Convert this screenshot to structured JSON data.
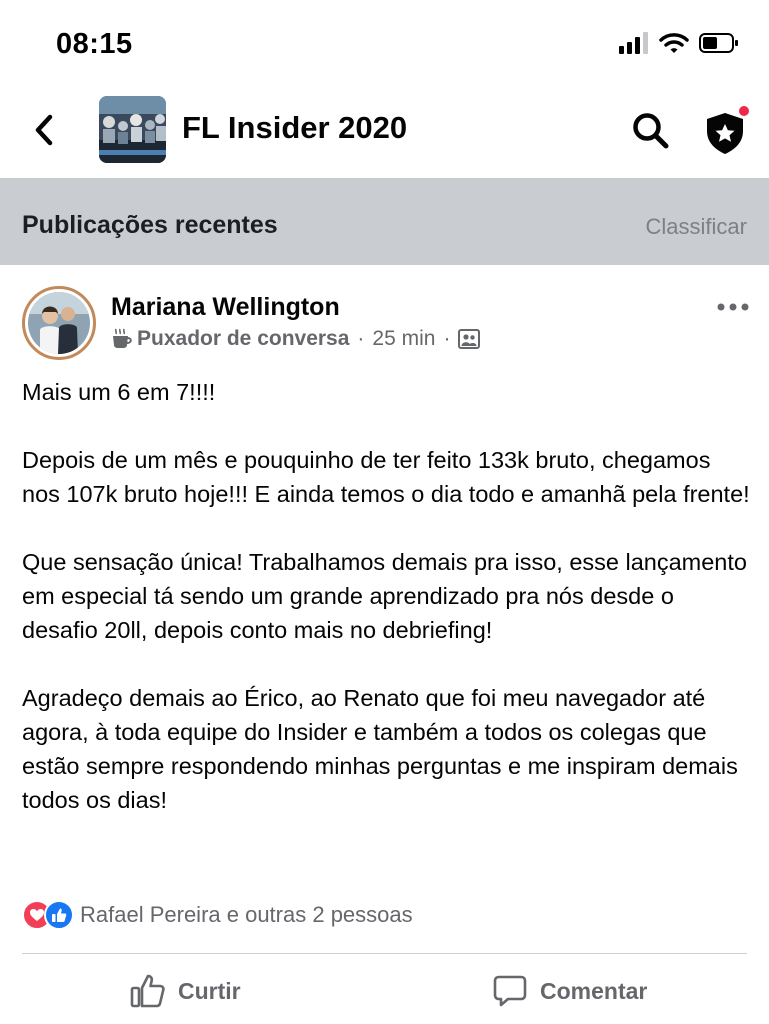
{
  "status_bar": {
    "time": "08:15"
  },
  "header": {
    "title": "FL Insider 2020"
  },
  "feed_section": {
    "title": "Publicações recentes",
    "sort_label": "Classificar"
  },
  "post": {
    "author": "Mariana Wellington",
    "badge": "Puxador de conversa",
    "time": "25 min",
    "separator": "·",
    "paragraphs": [
      "Mais um 6 em 7!!!!",
      "Depois de um mês e pouquinho de ter feito 133k bruto, chegamos nos 107k bruto hoje!!! E ainda temos o dia todo e amanhã pela frente!",
      "Que sensação única! Trabalhamos demais pra isso, esse lançamento em especial tá sendo um grande aprendizado pra nós desde o desafio 20ll, depois conto mais no debriefing!",
      "Agradeço demais ao Érico, ao Renato que foi meu navegador até agora, à toda equipe do Insider e também a todos os colegas que estão sempre respondendo minhas perguntas e me inspiram demais todos os dias!"
    ],
    "reactions_text": "Rafael Pereira e outras 2 pessoas"
  },
  "actions": {
    "like_label": "Curtir",
    "comment_label": "Comentar"
  },
  "colors": {
    "section_bg": "#c9ccd1",
    "secondary_text": "#65676b",
    "love_red": "#f33e58",
    "like_blue": "#1877f2",
    "notification_dot": "#f02849"
  },
  "icons": [
    "chevron-left-icon",
    "search-icon",
    "admin-shield-star-icon",
    "more-dots-icon",
    "coffee-cup-icon",
    "group-privacy-icon",
    "heart-reaction-icon",
    "like-reaction-icon",
    "thumbs-up-icon",
    "comment-bubble-icon",
    "signal-icon",
    "wifi-icon",
    "battery-icon"
  ]
}
